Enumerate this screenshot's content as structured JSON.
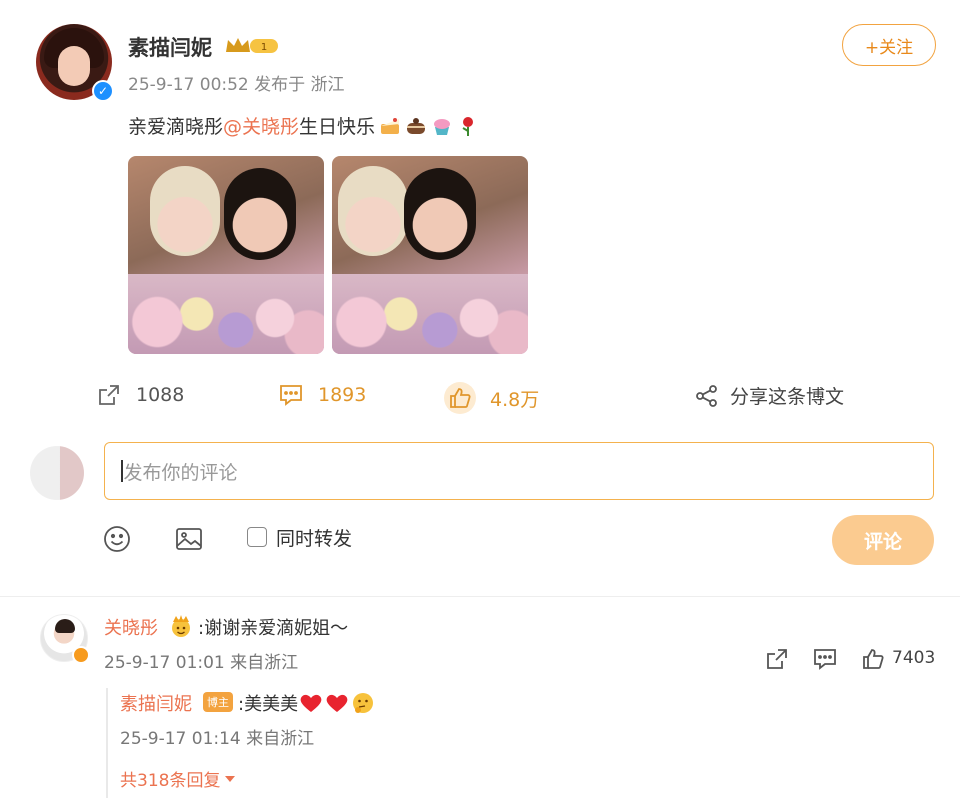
{
  "post": {
    "author": "素描闫妮",
    "meta": "25-9-17 00:52 发布于 浙江",
    "follow_label": "+关注",
    "text_prefix": "亲爱滴晓彤",
    "mention": "@关晓彤",
    "text_suffix": " 生日快乐",
    "emojis": [
      "cake-icon",
      "chocolate-cake-icon",
      "cupcake-icon",
      "rose-icon"
    ],
    "badge_level": "1"
  },
  "actions": {
    "share_count": "1088",
    "comment_count": "1893",
    "like_count": "4.8万",
    "share_label": "分享这条博文"
  },
  "composer": {
    "placeholder": "发布你的评论",
    "repost_label": "同时转发",
    "submit_label": "评论"
  },
  "comment": {
    "name": "关晓彤",
    "text": ":谢谢亲爱滴妮姐～",
    "meta": "25-9-17 01:01 来自浙江",
    "like_count": "7403"
  },
  "reply": {
    "name": "素描闫妮",
    "tag": "博主",
    "text": ":美美美",
    "meta": "25-9-17 01:14 来自浙江",
    "more_label": "共318条回复"
  },
  "colors": {
    "accent": "#eb7350",
    "orange": "#f2a340",
    "verified": "#1e90ff"
  }
}
